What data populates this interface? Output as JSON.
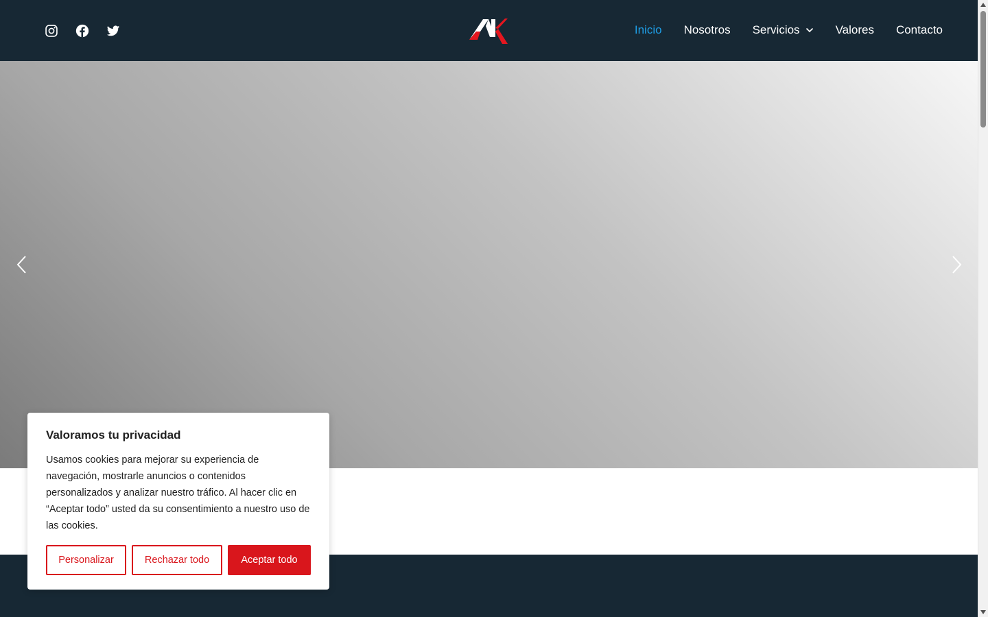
{
  "header": {
    "social": [
      {
        "name": "instagram-icon"
      },
      {
        "name": "facebook-icon"
      },
      {
        "name": "twitter-icon"
      }
    ],
    "logo_icon": "ak-logo",
    "nav": [
      {
        "label": "Inicio",
        "active": true
      },
      {
        "label": "Nosotros"
      },
      {
        "label": "Servicios",
        "has_dropdown": true
      },
      {
        "label": "Valores"
      },
      {
        "label": "Contacto"
      }
    ]
  },
  "hero": {
    "prev_icon": "chevron-left-icon",
    "next_icon": "chevron-right-icon"
  },
  "cookie_banner": {
    "title": "Valoramos tu privacidad",
    "text": "Usamos cookies para mejorar su experiencia de navegación, mostrarle anuncios o contenidos personalizados y analizar nuestro tráfico. Al hacer clic en “Aceptar todo” usted da su consentimiento a nuestro uso de las cookies.",
    "customize_label": "Personalizar",
    "reject_label": "Rechazar todo",
    "accept_label": "Aceptar todo"
  },
  "colors": {
    "header_bg": "#172834",
    "nav_active": "#1e9ee6",
    "brand_red": "#d9161c"
  }
}
